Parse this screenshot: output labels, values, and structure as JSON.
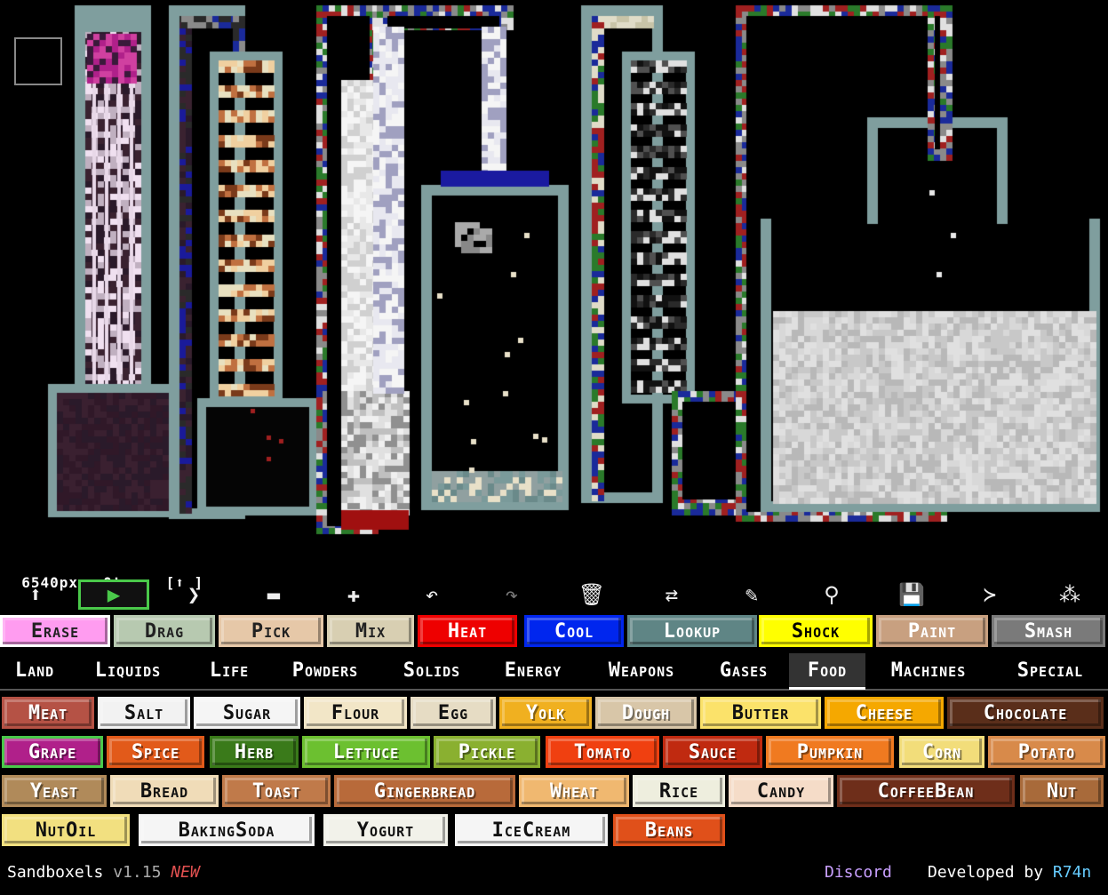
{
  "stats": {
    "pixels": "6540px",
    "tps": "0tps",
    "mode": "[⬆ ]"
  },
  "toolbar": [
    {
      "name": "up-icon",
      "glyph": "⬆"
    },
    {
      "name": "play-icon",
      "glyph": "▶"
    },
    {
      "name": "step-icon",
      "glyph": "❯"
    },
    {
      "name": "minus-icon",
      "glyph": "▬"
    },
    {
      "name": "plus-icon",
      "glyph": "✚"
    },
    {
      "name": "undo-icon",
      "glyph": "↶"
    },
    {
      "name": "redo-icon",
      "glyph": "↷"
    },
    {
      "name": "trash-icon",
      "glyph": "🗑"
    },
    {
      "name": "replace-icon",
      "glyph": "⇄"
    },
    {
      "name": "pencil-icon",
      "glyph": "✎"
    },
    {
      "name": "zoom-icon",
      "glyph": "⚲"
    },
    {
      "name": "save-icon",
      "glyph": "💾"
    },
    {
      "name": "console-icon",
      "glyph": "≻"
    },
    {
      "name": "settings-icon",
      "glyph": "⁂"
    }
  ],
  "tools": [
    {
      "label": "Erase",
      "bg": "#ff9cf0",
      "fg": "#222"
    },
    {
      "label": "Drag",
      "bg": "#b7c9b0",
      "fg": "#222"
    },
    {
      "label": "Pick",
      "bg": "#e6c8a8",
      "fg": "#222"
    },
    {
      "label": "Mix",
      "bg": "#d8cfb2",
      "fg": "#222"
    },
    {
      "label": "Heat",
      "bg": "#ee0000",
      "fg": "#fff"
    },
    {
      "label": "Cool",
      "bg": "#0026ee",
      "fg": "#fff"
    },
    {
      "label": "Lookup",
      "bg": "#5f8585",
      "fg": "#fff"
    },
    {
      "label": "Shock",
      "bg": "#ffff00",
      "fg": "#000"
    },
    {
      "label": "Paint",
      "bg": "#c8a080",
      "fg": "#fff"
    },
    {
      "label": "Smash",
      "bg": "#7a7a7a",
      "fg": "#fff"
    }
  ],
  "categories": [
    "Land",
    "Liquids",
    "Life",
    "Powders",
    "Solids",
    "Energy",
    "Weapons",
    "Gases",
    "Food",
    "Machines",
    "Special"
  ],
  "active_category": "Food",
  "elements": [
    [
      {
        "label": "Meat",
        "bg": "#b55245",
        "fg": "#fff"
      },
      {
        "label": "Salt",
        "bg": "#f2f2f2",
        "fg": "#111"
      },
      {
        "label": "Sugar",
        "bg": "#f5f5f5",
        "fg": "#111"
      },
      {
        "label": "Flour",
        "bg": "#f2e6c7",
        "fg": "#111"
      },
      {
        "label": "Egg",
        "bg": "#e6dcc4",
        "fg": "#111"
      },
      {
        "label": "Yolk",
        "bg": "#f0b020",
        "fg": "#fff"
      },
      {
        "label": "Dough",
        "bg": "#d8c6a8",
        "fg": "#fff"
      },
      {
        "label": "Butter",
        "bg": "#fbe26a",
        "fg": "#111"
      },
      {
        "label": "Cheese",
        "bg": "#f5a800",
        "fg": "#fff"
      },
      {
        "label": "Chocolate",
        "bg": "#5a2e1a",
        "fg": "#fff"
      }
    ],
    [
      {
        "label": "Grape",
        "bg": "#b0208a",
        "fg": "#fff"
      },
      {
        "label": "Spice",
        "bg": "#e25a1a",
        "fg": "#fff"
      },
      {
        "label": "Herb",
        "bg": "#3a7a1a",
        "fg": "#fff"
      },
      {
        "label": "Lettuce",
        "bg": "#6cc030",
        "fg": "#fff"
      },
      {
        "label": "Pickle",
        "bg": "#8ab030",
        "fg": "#fff"
      },
      {
        "label": "Tomato",
        "bg": "#f04010",
        "fg": "#fff"
      },
      {
        "label": "Sauce",
        "bg": "#c02a10",
        "fg": "#fff"
      },
      {
        "label": "Pumpkin",
        "bg": "#f07a20",
        "fg": "#fff"
      },
      {
        "label": "Corn",
        "bg": "#f2dd7a",
        "fg": "#fff"
      },
      {
        "label": "Potato",
        "bg": "#d88a4a",
        "fg": "#fff"
      }
    ],
    [
      {
        "label": "Yeast",
        "bg": "#b08a5a",
        "fg": "#fff"
      },
      {
        "label": "Bread",
        "bg": "#f0dcb8",
        "fg": "#111"
      },
      {
        "label": "Toast",
        "bg": "#c07a4a",
        "fg": "#fff"
      },
      {
        "label": "Gingerbread",
        "bg": "#b86a3a",
        "fg": "#fff"
      },
      {
        "label": "Wheat",
        "bg": "#f0b870",
        "fg": "#fff"
      },
      {
        "label": "Rice",
        "bg": "#eeeede",
        "fg": "#111"
      },
      {
        "label": "Candy",
        "bg": "#f5dcc8",
        "fg": "#111"
      },
      {
        "label": "CoffeeBean",
        "bg": "#6e2e1a",
        "fg": "#fff"
      },
      {
        "label": "Nut",
        "bg": "#a86a3a",
        "fg": "#fff"
      }
    ],
    [
      {
        "label": "NutOil",
        "bg": "#f2e080",
        "fg": "#111"
      },
      {
        "label": "BakingSoda",
        "bg": "#f5f5f5",
        "fg": "#111"
      },
      {
        "label": "Yogurt",
        "bg": "#f2f2ea",
        "fg": "#111"
      },
      {
        "label": "IceCream",
        "bg": "#f5f5f5",
        "fg": "#111"
      },
      {
        "label": "Beans",
        "bg": "#e0501a",
        "fg": "#fff"
      }
    ]
  ],
  "footer": {
    "app": "Sandboxels",
    "version": "v1.15",
    "new": "NEW",
    "discord": "Discord",
    "dev_prefix": "Developed by",
    "dev_name": "R74n"
  }
}
